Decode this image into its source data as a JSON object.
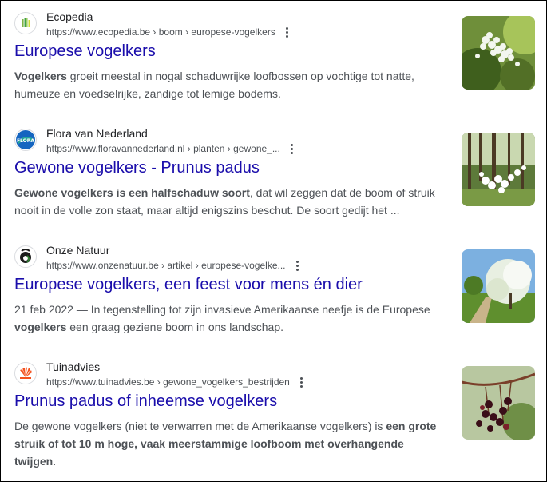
{
  "results": [
    {
      "site_name": "Ecopedia",
      "url": "https://www.ecopedia.be › boom › europese-vogelkers",
      "title": "Europese vogelkers",
      "snippet": [
        {
          "text": "Vogelkers",
          "bold": true
        },
        {
          "text": " groeit meestal in nogal schaduwrijke loofbossen op vochtige tot natte, humeuze en voedselrijke, zandige tot lemige bodems.",
          "bold": false
        }
      ],
      "favicon_icon": "ecopedia-grass-icon",
      "thumbnail": "white-blossom-cluster-image"
    },
    {
      "site_name": "Flora van Nederland",
      "url": "https://www.floravannederland.nl › planten › gewone_...",
      "title": "Gewone vogelkers - Prunus padus",
      "snippet": [
        {
          "text": "Gewone vogelkers is een halfschaduw soort",
          "bold": true
        },
        {
          "text": ", dat wil zeggen dat de boom of struik nooit in de volle zon staat, maar altijd enigszins beschut. De soort gedijt het ...",
          "bold": false
        }
      ],
      "favicon_icon": "flora-globe-icon",
      "thumbnail": "forest-blossom-image"
    },
    {
      "site_name": "Onze Natuur",
      "url": "https://www.onzenatuur.be › artikel › europese-vogelke...",
      "title": "Europese vogelkers, een feest voor mens én dier",
      "snippet": [
        {
          "text": "21 feb 2022 — In tegenstelling tot zijn invasieve Amerikaanse neefje is de Europese ",
          "bold": false
        },
        {
          "text": "vogelkers",
          "bold": true
        },
        {
          "text": " een graag geziene boom in ons landschap.",
          "bold": false
        }
      ],
      "favicon_icon": "onze-natuur-drop-icon",
      "thumbnail": "blossoming-tree-path-image"
    },
    {
      "site_name": "Tuinadvies",
      "url": "https://www.tuinadvies.be › gewone_vogelkers_bestrijden",
      "title": "Prunus padus of inheemse vogelkers",
      "snippet": [
        {
          "text": "De gewone vogelkers (niet te verwarren met de Amerikaanse vogelkers) is ",
          "bold": false
        },
        {
          "text": "een grote struik of tot 10 m hoge, vaak meerstammige loofboom met overhangende twijgen",
          "bold": true
        },
        {
          "text": ".",
          "bold": false
        }
      ],
      "favicon_icon": "tuinadvies-sun-icon",
      "thumbnail": "dark-berries-image"
    }
  ]
}
